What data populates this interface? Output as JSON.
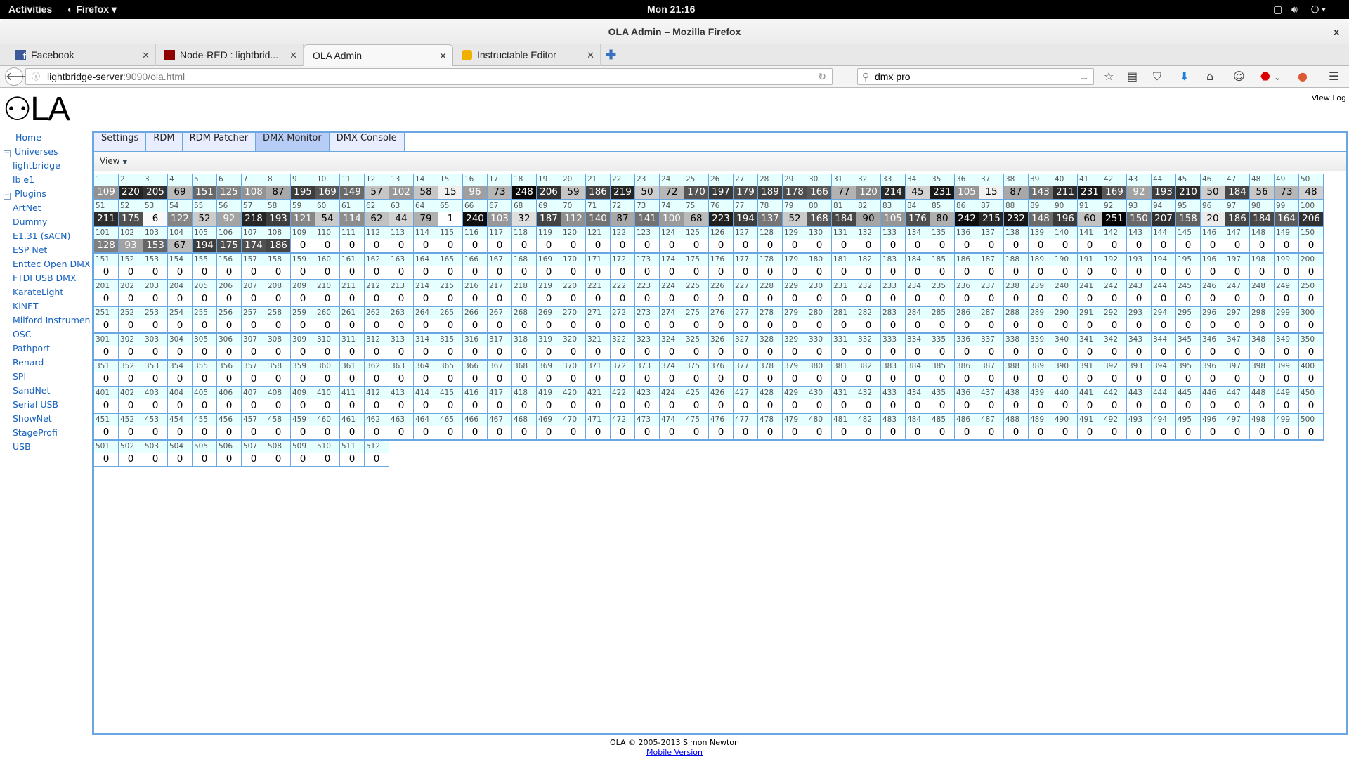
{
  "system": {
    "activities": "Activities",
    "app": "Firefox ▾",
    "clock": "Mon 21:16"
  },
  "window": {
    "title": "OLA Admin – Mozilla Firefox",
    "close": "x"
  },
  "browser_tabs": [
    {
      "label": "Facebook",
      "icon": "facebook-icon"
    },
    {
      "label": "Node-RED : lightbrid...",
      "icon": "node-red-icon"
    },
    {
      "label": "OLA Admin",
      "active": true
    },
    {
      "label": "Instructable Editor",
      "icon": "instructables-icon"
    }
  ],
  "nav": {
    "url_host": "lightbridge-server",
    "url_rest": ":9090/ola.html",
    "search_value": "dmx pro"
  },
  "page": {
    "logo": "OLA",
    "view_log": "View Log"
  },
  "sidebar": {
    "home": "Home",
    "universes_label": "Universes",
    "universes": [
      "lightbridge",
      "lb e1"
    ],
    "plugins_label": "Plugins",
    "plugins": [
      "ArtNet",
      "Dummy",
      "E1.31 (sACN)",
      "ESP Net",
      "Enttec Open DMX",
      "FTDI USB DMX",
      "KarateLight",
      "KiNET",
      "Milford Instruments",
      "OSC",
      "Pathport",
      "Renard",
      "SPI",
      "SandNet",
      "Serial USB",
      "ShowNet",
      "StageProfi",
      "USB"
    ]
  },
  "panel_tabs": [
    {
      "label": "Settings"
    },
    {
      "label": "RDM"
    },
    {
      "label": "RDM Patcher"
    },
    {
      "label": "DMX Monitor",
      "selected": true
    },
    {
      "label": "DMX Console"
    }
  ],
  "view_menu": "View",
  "dmx_values_nonzero": [
    109,
    220,
    205,
    69,
    151,
    125,
    108,
    87,
    195,
    169,
    149,
    57,
    102,
    58,
    15,
    96,
    73,
    248,
    206,
    59,
    186,
    219,
    50,
    72,
    170,
    197,
    179,
    189,
    178,
    166,
    77,
    120,
    214,
    45,
    231,
    105,
    15,
    87,
    143,
    211,
    231,
    169,
    92,
    193,
    210,
    50,
    184,
    56,
    73,
    48,
    211,
    175,
    6,
    122,
    52,
    92,
    218,
    193,
    121,
    54,
    114,
    62,
    44,
    79,
    1,
    240,
    103,
    32,
    187,
    112,
    140,
    87,
    141,
    100,
    68,
    223,
    194,
    137,
    52,
    168,
    184,
    90,
    105,
    176,
    80,
    242,
    215,
    232,
    148,
    196,
    60,
    251,
    150,
    207,
    158,
    20,
    186,
    184,
    164,
    206,
    128,
    93,
    153,
    67,
    194,
    175,
    174,
    186
  ],
  "channel_count": 512,
  "footer": {
    "copyright": "OLA © 2005-2013 Simon Newton",
    "mobile": "Mobile Version"
  },
  "colors": {
    "accent": "#6aa6e0",
    "label_bg": "#e6ffff",
    "link": "#1560bd"
  }
}
